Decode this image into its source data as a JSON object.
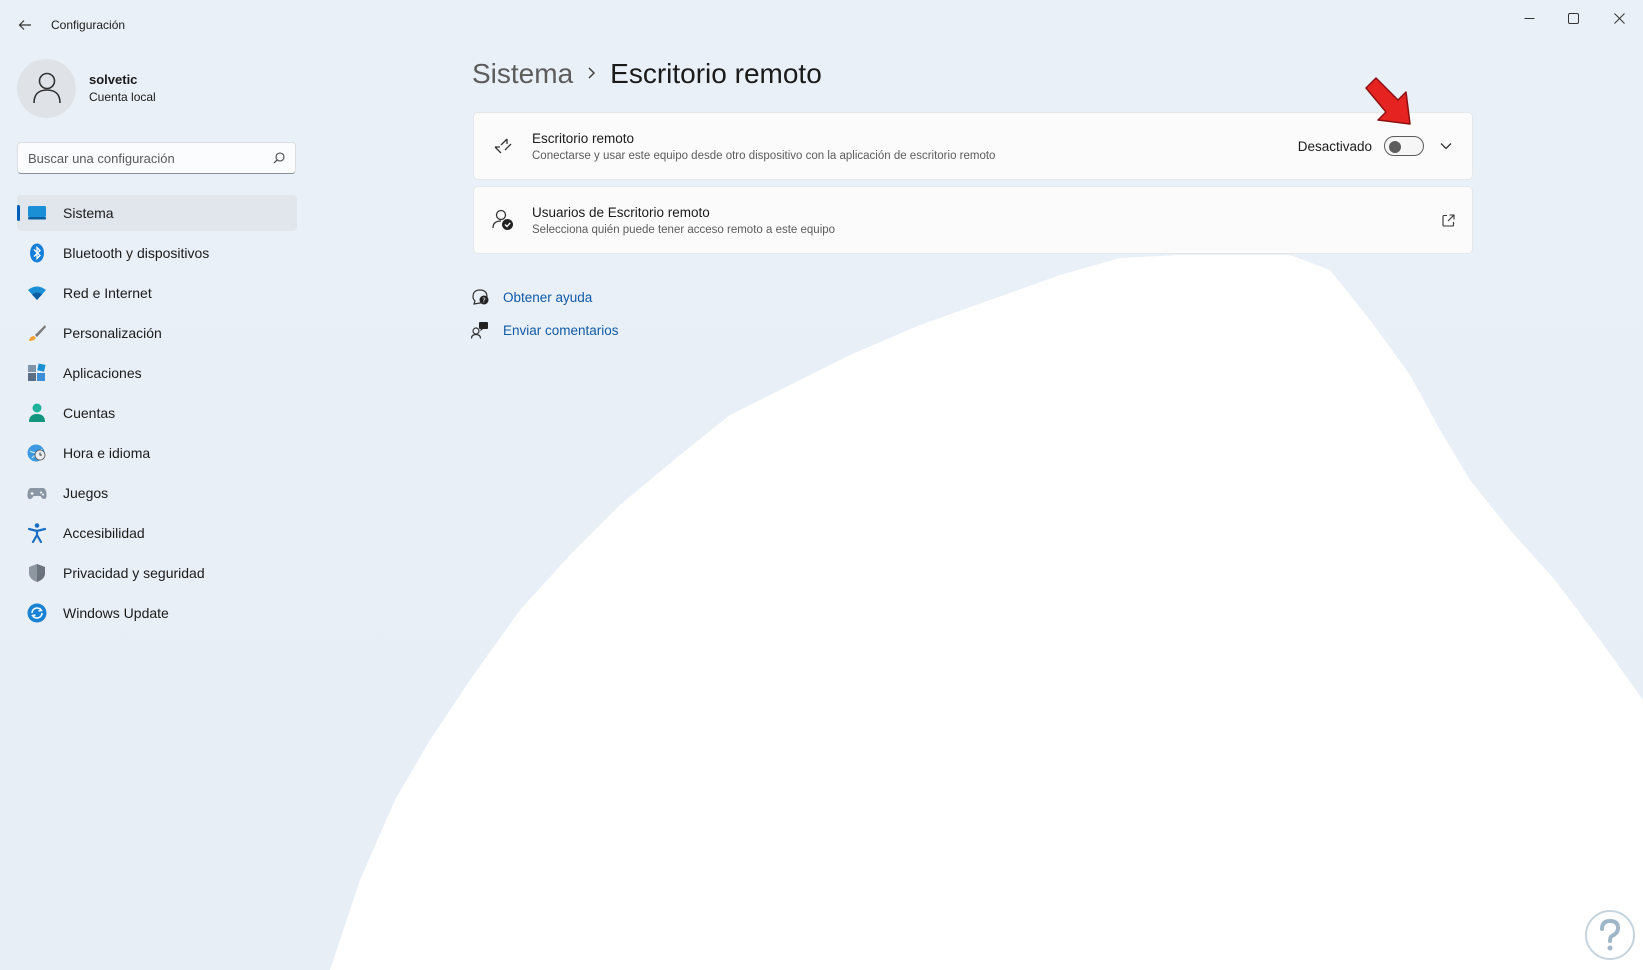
{
  "window": {
    "app_title": "Configuración"
  },
  "profile": {
    "name": "solvetic",
    "account_type": "Cuenta local"
  },
  "search": {
    "placeholder": "Buscar una configuración"
  },
  "sidebar": {
    "items": [
      {
        "label": "Sistema",
        "icon": "system-icon",
        "active": true
      },
      {
        "label": "Bluetooth y dispositivos",
        "icon": "bluetooth-icon"
      },
      {
        "label": "Red e Internet",
        "icon": "wifi-icon"
      },
      {
        "label": "Personalización",
        "icon": "brush-icon"
      },
      {
        "label": "Aplicaciones",
        "icon": "apps-icon"
      },
      {
        "label": "Cuentas",
        "icon": "account-icon"
      },
      {
        "label": "Hora e idioma",
        "icon": "globe-clock-icon"
      },
      {
        "label": "Juegos",
        "icon": "gamepad-icon"
      },
      {
        "label": "Accesibilidad",
        "icon": "accessibility-icon"
      },
      {
        "label": "Privacidad y seguridad",
        "icon": "shield-icon"
      },
      {
        "label": "Windows Update",
        "icon": "update-icon"
      }
    ]
  },
  "breadcrumb": {
    "parent": "Sistema",
    "current": "Escritorio remoto"
  },
  "cards": {
    "remote_desktop": {
      "title": "Escritorio remoto",
      "subtitle": "Conectarse y usar este equipo desde otro dispositivo con la aplicación de escritorio remoto",
      "toggle_label": "Desactivado",
      "toggle_on": false
    },
    "remote_users": {
      "title": "Usuarios de Escritorio remoto",
      "subtitle": "Selecciona quién puede tener acceso remoto a este equipo"
    }
  },
  "links": {
    "help": "Obtener ayuda",
    "feedback": "Enviar comentarios"
  },
  "colors": {
    "accent": "#005fb8",
    "link": "#0f5ba7",
    "annotation_arrow": "#e52421"
  }
}
